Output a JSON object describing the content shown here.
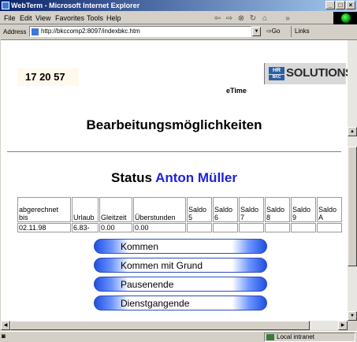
{
  "window": {
    "title": "WebTerm - Microsoft Internet Explorer",
    "buttons": [
      "_",
      "□",
      "×"
    ]
  },
  "menu": [
    "File",
    "Edit",
    "View",
    "Favorites",
    "Tools",
    "Help"
  ],
  "nav": {
    "back": "⇦",
    "forward": "⇨",
    "stop": "⊗",
    "refresh": "↻",
    "home": "⌂",
    "more": "»"
  },
  "address": {
    "label": "Address",
    "url": "http://bkccomp2:8097/indexbkc.htm",
    "go": "Go",
    "links": "Links"
  },
  "page": {
    "clock": "17 20 57",
    "etime": "eTime",
    "brand_hr": "HR",
    "brand_bkc": "BKC",
    "brand_solutions": "SOLUTIONS",
    "heading": "Bearbeitungsmöglichkeiten",
    "status_label": "Status",
    "status_name": "Anton Müller"
  },
  "table": {
    "headers": [
      "abgerechnet bis",
      "Urlaub",
      "Gleitzeit",
      "Überstunden",
      "Saldo 5",
      "Saldo 6",
      "Saldo 7",
      "Saldo 8",
      "Saldo 9",
      "Saldo A"
    ],
    "row": [
      "02.11.98",
      "6.83-",
      "0.00",
      "0.00",
      "",
      "",
      "",
      "",
      "",
      ""
    ]
  },
  "actions": [
    "Kommen",
    "Kommen mit Grund",
    "Pausenende",
    "Dienstgangende"
  ],
  "statusbar": {
    "zone": "Local intranet"
  },
  "colors": {
    "name_blue": "#1f1fe0",
    "button_blue": "#1f4fe0",
    "title_blue": "#0a246a"
  }
}
